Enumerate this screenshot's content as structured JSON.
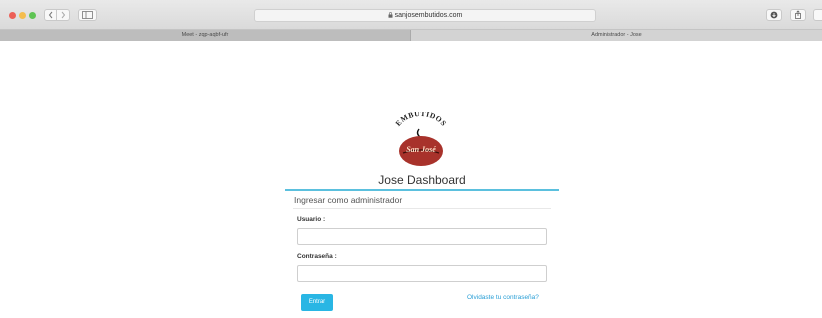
{
  "browser": {
    "url": "sanjosembutidos.com",
    "tabs": [
      {
        "label": "Meet - zqp-aqbf-ufr"
      },
      {
        "label": "Administrador - Jose"
      }
    ]
  },
  "page": {
    "logo": {
      "arc_text": "EMBUTIDOS",
      "script_text": "San José"
    },
    "title": "Jose Dashboard",
    "panel_heading": "Ingresar como administrador",
    "fields": {
      "user_label": "Usuario :",
      "user_value": "",
      "pass_label": "Contraseña :",
      "pass_value": ""
    },
    "submit_label": "Entrar",
    "forgot_link": "Olvidaste tu contraseña?"
  },
  "colors": {
    "accent": "#5bc0de",
    "button": "#29b6e4",
    "link": "#2a9fd6",
    "logo_red": "#a8322b"
  }
}
